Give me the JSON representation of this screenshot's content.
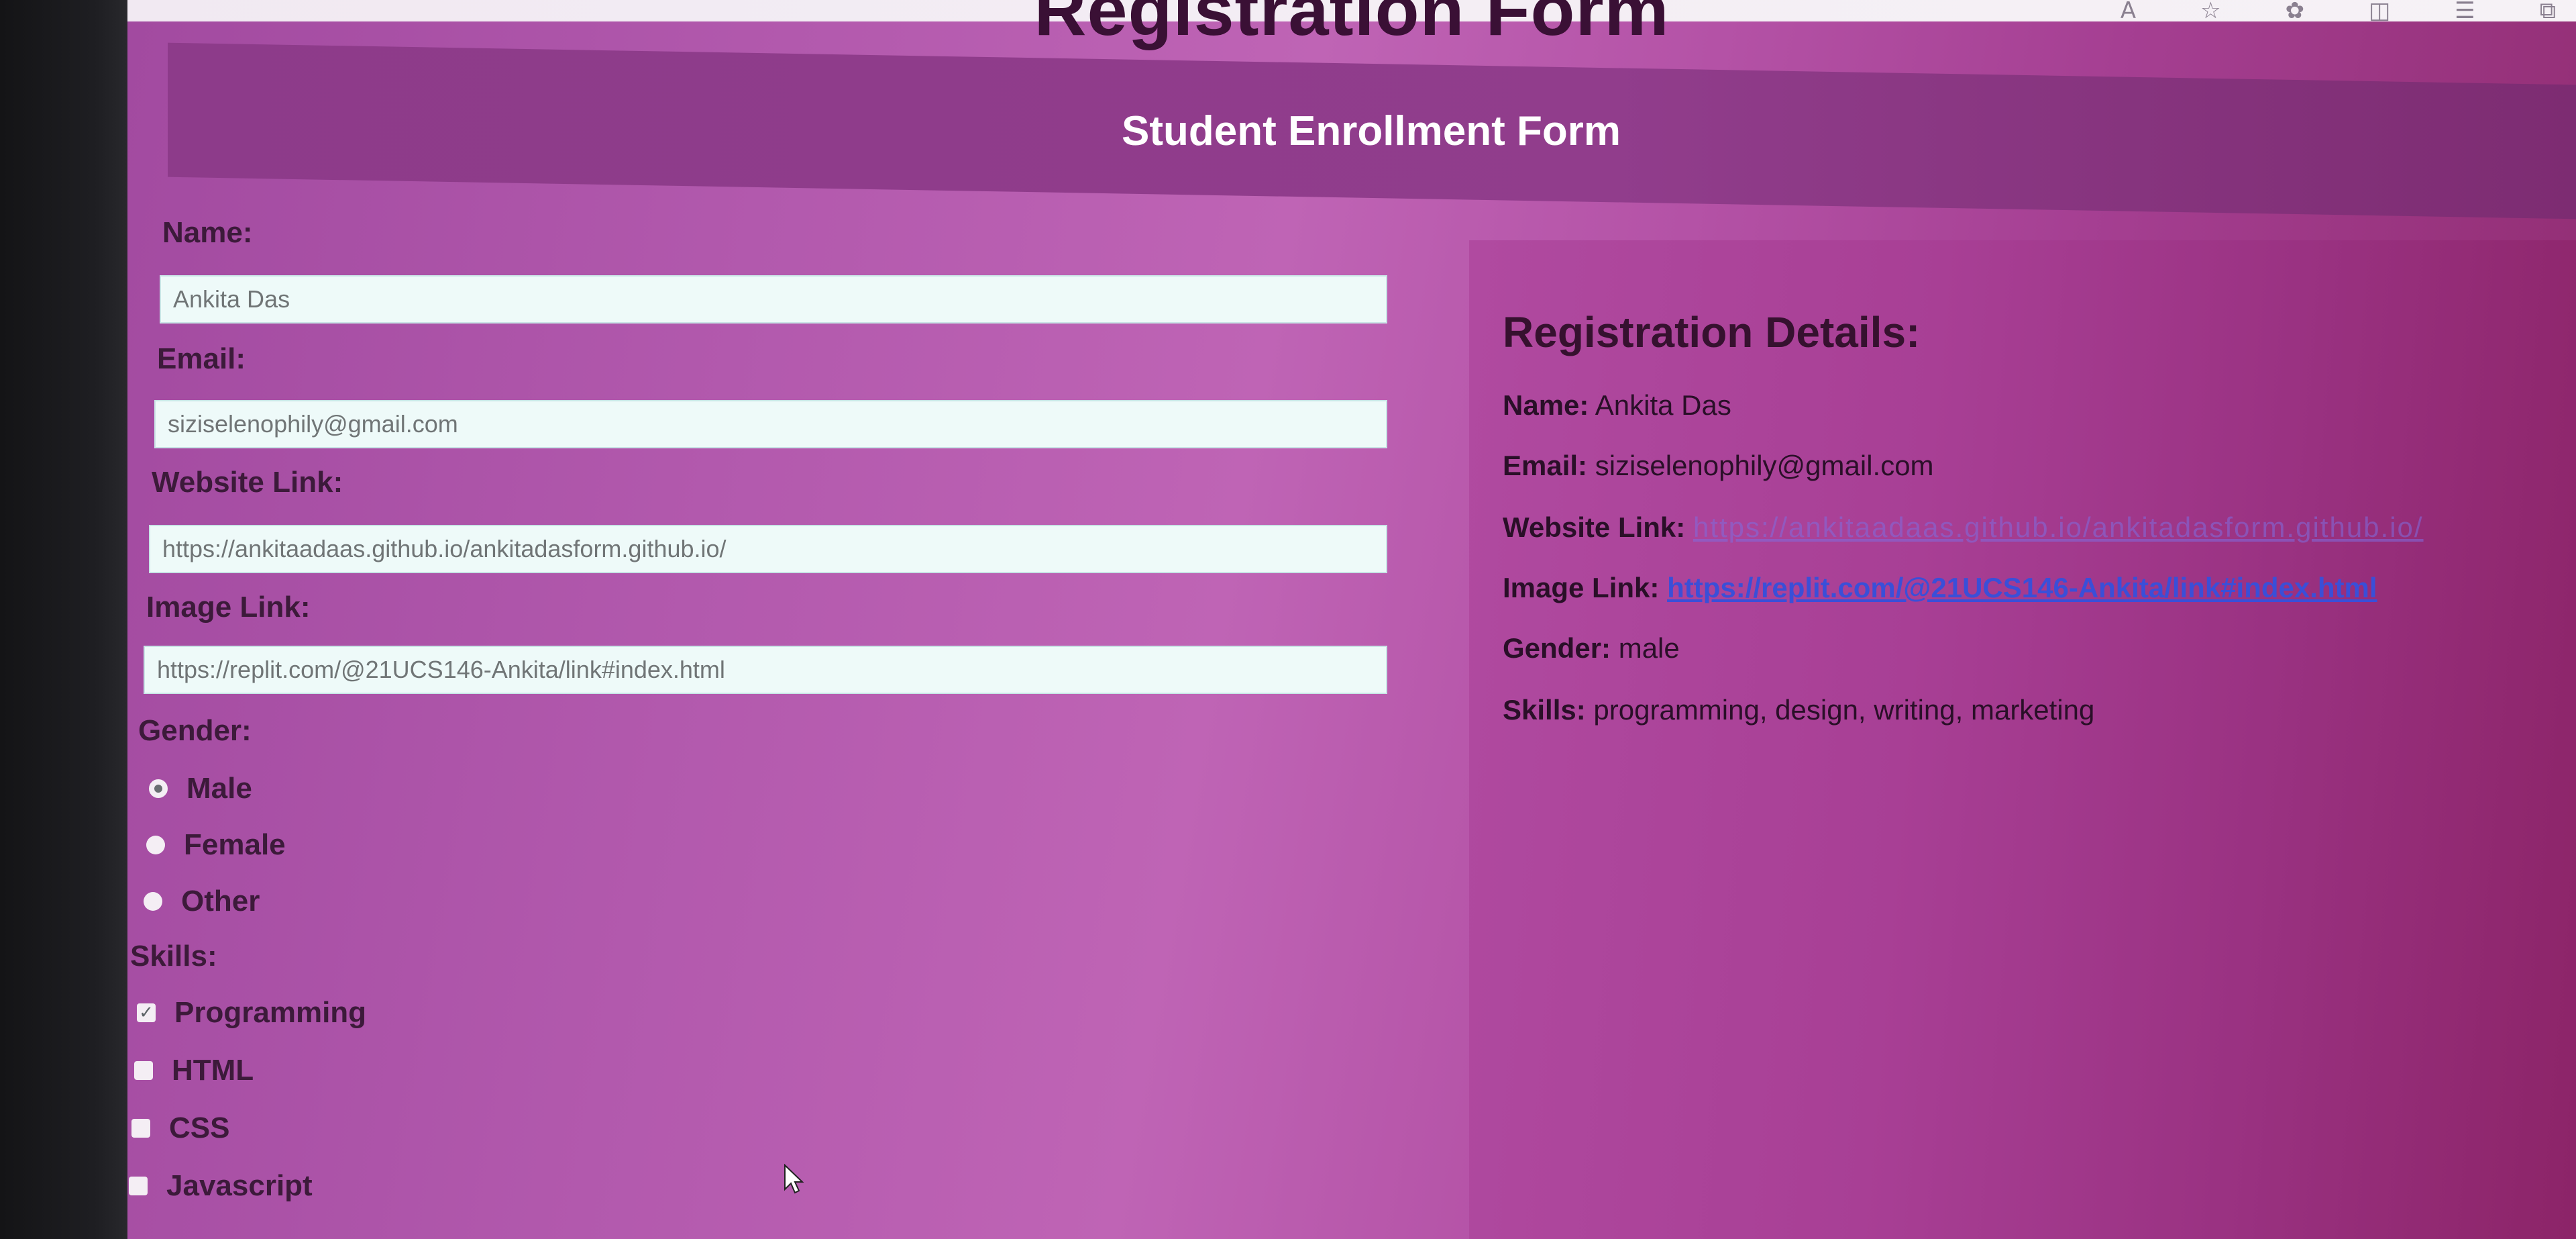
{
  "browser": {
    "icons": [
      "read-aloud-icon",
      "favorite-star-icon",
      "extensions-icon",
      "split-screen-icon",
      "favorites-list-icon",
      "collections-icon"
    ]
  },
  "page": {
    "title": "Registration Form",
    "form_header": "Student Enrollment Form"
  },
  "form": {
    "name_label": "Name:",
    "name_value": "Ankita Das",
    "email_label": "Email:",
    "email_value": "siziselenophily@gmail.com",
    "website_label": "Website Link:",
    "website_value": "https://ankitaadaas.github.io/ankitadasform.github.io/",
    "image_label": "Image Link:",
    "image_value": "https://replit.com/@21UCS146-Ankita/link#index.html",
    "gender_label": "Gender:",
    "gender_options": [
      {
        "label": "Male",
        "checked": true
      },
      {
        "label": "Female",
        "checked": false
      },
      {
        "label": "Other",
        "checked": false
      }
    ],
    "skills_label": "Skills:",
    "skills_options": [
      {
        "label": "Programming",
        "checked": true
      },
      {
        "label": "HTML",
        "checked": false
      },
      {
        "label": "CSS",
        "checked": false
      },
      {
        "label": "Javascript",
        "checked": false
      }
    ]
  },
  "details": {
    "title": "Registration Details:",
    "name_key": "Name:",
    "name_val": "Ankita Das",
    "email_key": "Email:",
    "email_val": "siziselenophily@gmail.com",
    "website_key": "Website Link:",
    "website_val": "https://ankitaadaas.github.io/ankitadasform.github.io/",
    "image_key": "Image Link:",
    "image_val": "https://replit.com/@21UCS146-Ankita/link#index.html",
    "gender_key": "Gender:",
    "gender_val": "male",
    "skills_key": "Skills:",
    "skills_val": "programming, design, writing, marketing"
  },
  "colors": {
    "page_bg": "#b85aad",
    "header_bg": "#8d3b8a",
    "input_bg": "#eefaf9",
    "link": "#3a4fd8"
  }
}
